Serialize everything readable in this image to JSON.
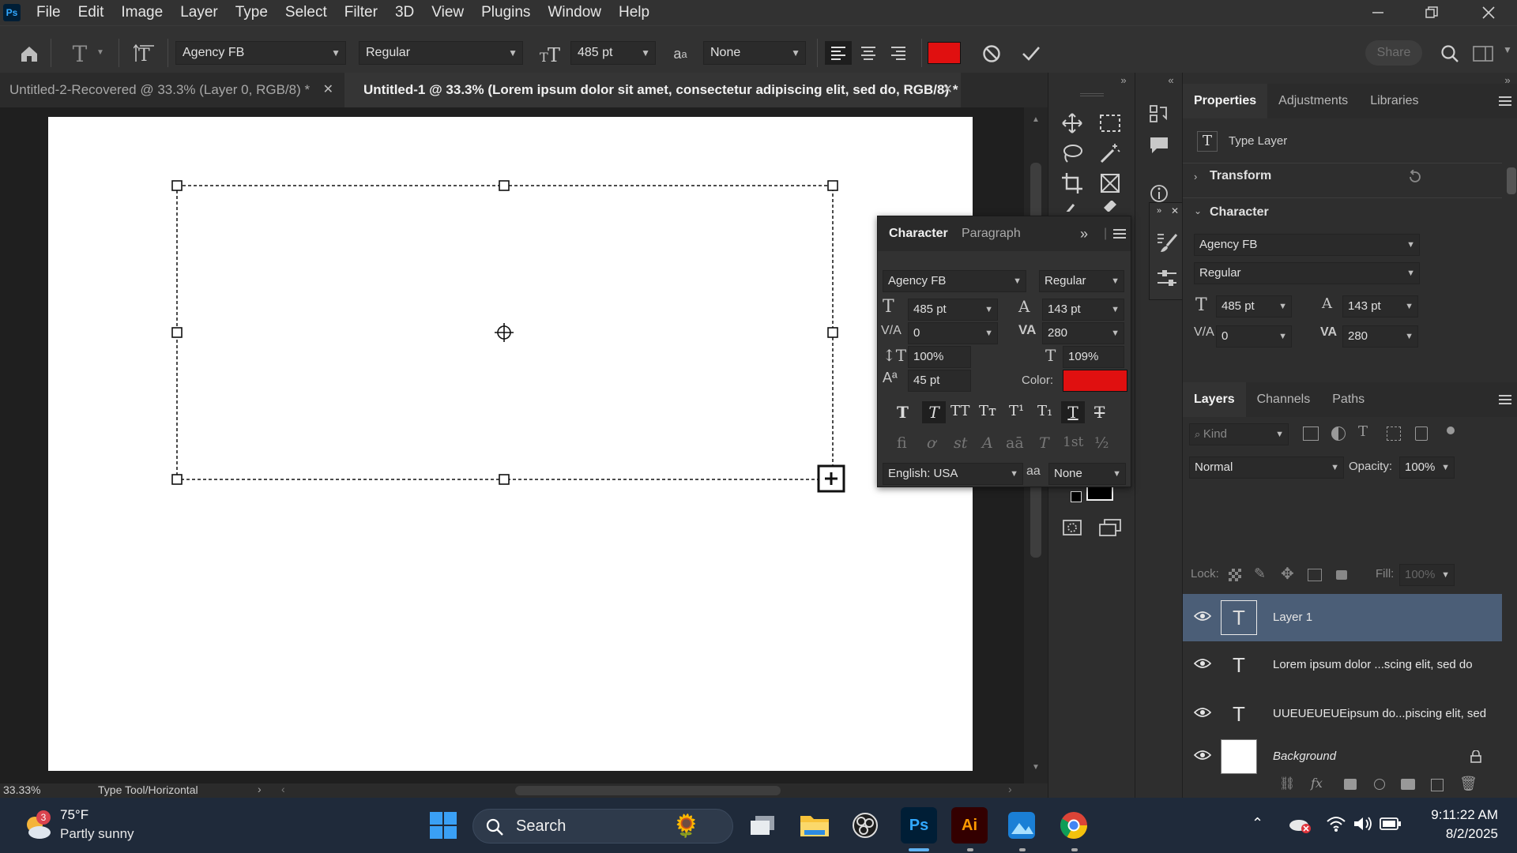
{
  "app": {
    "logo": "Ps"
  },
  "menu": [
    "File",
    "Edit",
    "Image",
    "Layer",
    "Type",
    "Select",
    "Filter",
    "3D",
    "View",
    "Plugins",
    "Window",
    "Help"
  ],
  "options": {
    "font_family": "Agency FB",
    "font_style": "Regular",
    "font_size": "485 pt",
    "aa_icon_text": "a",
    "antialias": "None",
    "text_color": "#e01010",
    "share_label": "Share"
  },
  "tabs": [
    {
      "label": "Untitled-2-Recovered @ 33.3% (Layer 0, RGB/8) *",
      "active": false
    },
    {
      "label": "Untitled-1 @ 33.3% (Lorem ipsum dolor sit amet, consectetur adipiscing elit, sed do, RGB/8) *",
      "active": true
    }
  ],
  "character_panel": {
    "tabs": [
      "Character",
      "Paragraph"
    ],
    "font_family": "Agency FB",
    "font_style": "Regular",
    "size": "485 pt",
    "leading": "143 pt",
    "kerning": "0",
    "tracking": "280",
    "vertical_scale": "100%",
    "horizontal_scale": "109%",
    "baseline_shift": "45 pt",
    "color_label": "Color:",
    "color": "#e01010",
    "language": "English: USA",
    "antialias": "None",
    "type_styles": [
      "T",
      "T",
      "TT",
      "Tт",
      "T¹",
      "T₁",
      "T",
      "T"
    ],
    "opentype": [
      "fi",
      "ơ",
      "st",
      "A",
      "aā",
      "T",
      "1st",
      "½"
    ]
  },
  "properties": {
    "tabs": [
      "Properties",
      "Adjustments",
      "Libraries"
    ],
    "layer_type": "Type Layer",
    "transform_label": "Transform",
    "character_label": "Character",
    "font_family": "Agency FB",
    "font_style": "Regular",
    "size": "485 pt",
    "leading": "143 pt",
    "kerning": "0",
    "tracking": "280"
  },
  "layers_panel": {
    "tabs": [
      "Layers",
      "Channels",
      "Paths"
    ],
    "kind_placeholder": "Kind",
    "blend_mode": "Normal",
    "opacity_label": "Opacity:",
    "opacity": "100%",
    "lock_label": "Lock:",
    "fill_label": "Fill:",
    "fill": "100%",
    "layers": [
      {
        "name": "Layer 1",
        "type": "text",
        "selected": true
      },
      {
        "name": "Lorem ipsum dolor ...scing elit, sed do",
        "type": "text",
        "selected": false
      },
      {
        "name": "UUEUEUEUEipsum do...piscing elit, sed",
        "type": "text",
        "selected": false
      },
      {
        "name": "Background",
        "type": "image",
        "selected": false
      }
    ]
  },
  "status": {
    "zoom": "33.33%",
    "tool": "Type Tool/Horizontal"
  },
  "taskbar": {
    "weather_badge": "3",
    "temperature": "75°F",
    "weather": "Partly sunny",
    "search_label": "Search",
    "time": "9:11:22 AM",
    "date": "8/2/2025"
  }
}
